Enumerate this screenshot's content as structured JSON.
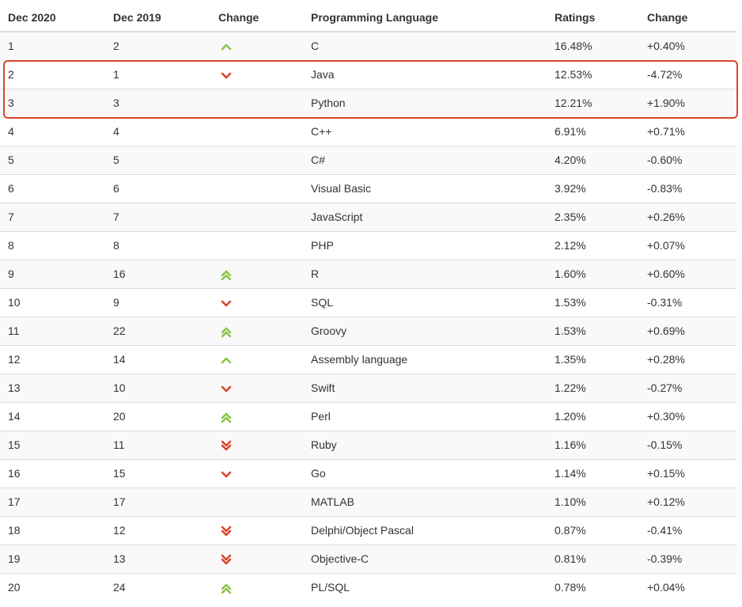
{
  "table": {
    "headers": [
      "Dec 2020",
      "Dec 2019",
      "Change",
      "Programming Language",
      "Ratings",
      "Change"
    ],
    "rows": [
      {
        "now": "1",
        "prev": "2",
        "trend": "up",
        "language": "C",
        "rating": "16.48%",
        "delta": "+0.40%"
      },
      {
        "now": "2",
        "prev": "1",
        "trend": "down",
        "language": "Java",
        "rating": "12.53%",
        "delta": "-4.72%"
      },
      {
        "now": "3",
        "prev": "3",
        "trend": "",
        "language": "Python",
        "rating": "12.21%",
        "delta": "+1.90%"
      },
      {
        "now": "4",
        "prev": "4",
        "trend": "",
        "language": "C++",
        "rating": "6.91%",
        "delta": "+0.71%"
      },
      {
        "now": "5",
        "prev": "5",
        "trend": "",
        "language": "C#",
        "rating": "4.20%",
        "delta": "-0.60%"
      },
      {
        "now": "6",
        "prev": "6",
        "trend": "",
        "language": "Visual Basic",
        "rating": "3.92%",
        "delta": "-0.83%"
      },
      {
        "now": "7",
        "prev": "7",
        "trend": "",
        "language": "JavaScript",
        "rating": "2.35%",
        "delta": "+0.26%"
      },
      {
        "now": "8",
        "prev": "8",
        "trend": "",
        "language": "PHP",
        "rating": "2.12%",
        "delta": "+0.07%"
      },
      {
        "now": "9",
        "prev": "16",
        "trend": "double-up",
        "language": "R",
        "rating": "1.60%",
        "delta": "+0.60%"
      },
      {
        "now": "10",
        "prev": "9",
        "trend": "down",
        "language": "SQL",
        "rating": "1.53%",
        "delta": "-0.31%"
      },
      {
        "now": "11",
        "prev": "22",
        "trend": "double-up",
        "language": "Groovy",
        "rating": "1.53%",
        "delta": "+0.69%"
      },
      {
        "now": "12",
        "prev": "14",
        "trend": "up",
        "language": "Assembly language",
        "rating": "1.35%",
        "delta": "+0.28%"
      },
      {
        "now": "13",
        "prev": "10",
        "trend": "down",
        "language": "Swift",
        "rating": "1.22%",
        "delta": "-0.27%"
      },
      {
        "now": "14",
        "prev": "20",
        "trend": "double-up",
        "language": "Perl",
        "rating": "1.20%",
        "delta": "+0.30%"
      },
      {
        "now": "15",
        "prev": "11",
        "trend": "double-down",
        "language": "Ruby",
        "rating": "1.16%",
        "delta": "-0.15%"
      },
      {
        "now": "16",
        "prev": "15",
        "trend": "down",
        "language": "Go",
        "rating": "1.14%",
        "delta": "+0.15%"
      },
      {
        "now": "17",
        "prev": "17",
        "trend": "",
        "language": "MATLAB",
        "rating": "1.10%",
        "delta": "+0.12%"
      },
      {
        "now": "18",
        "prev": "12",
        "trend": "double-down",
        "language": "Delphi/Object Pascal",
        "rating": "0.87%",
        "delta": "-0.41%"
      },
      {
        "now": "19",
        "prev": "13",
        "trend": "double-down",
        "language": "Objective-C",
        "rating": "0.81%",
        "delta": "-0.39%"
      },
      {
        "now": "20",
        "prev": "24",
        "trend": "double-up",
        "language": "PL/SQL",
        "rating": "0.78%",
        "delta": "+0.04%"
      }
    ]
  },
  "colors": {
    "up": "#8bc34a",
    "down": "#d9452b",
    "highlight": "#d9452b"
  },
  "highlight": {
    "rows": [
      "2",
      "3"
    ]
  }
}
